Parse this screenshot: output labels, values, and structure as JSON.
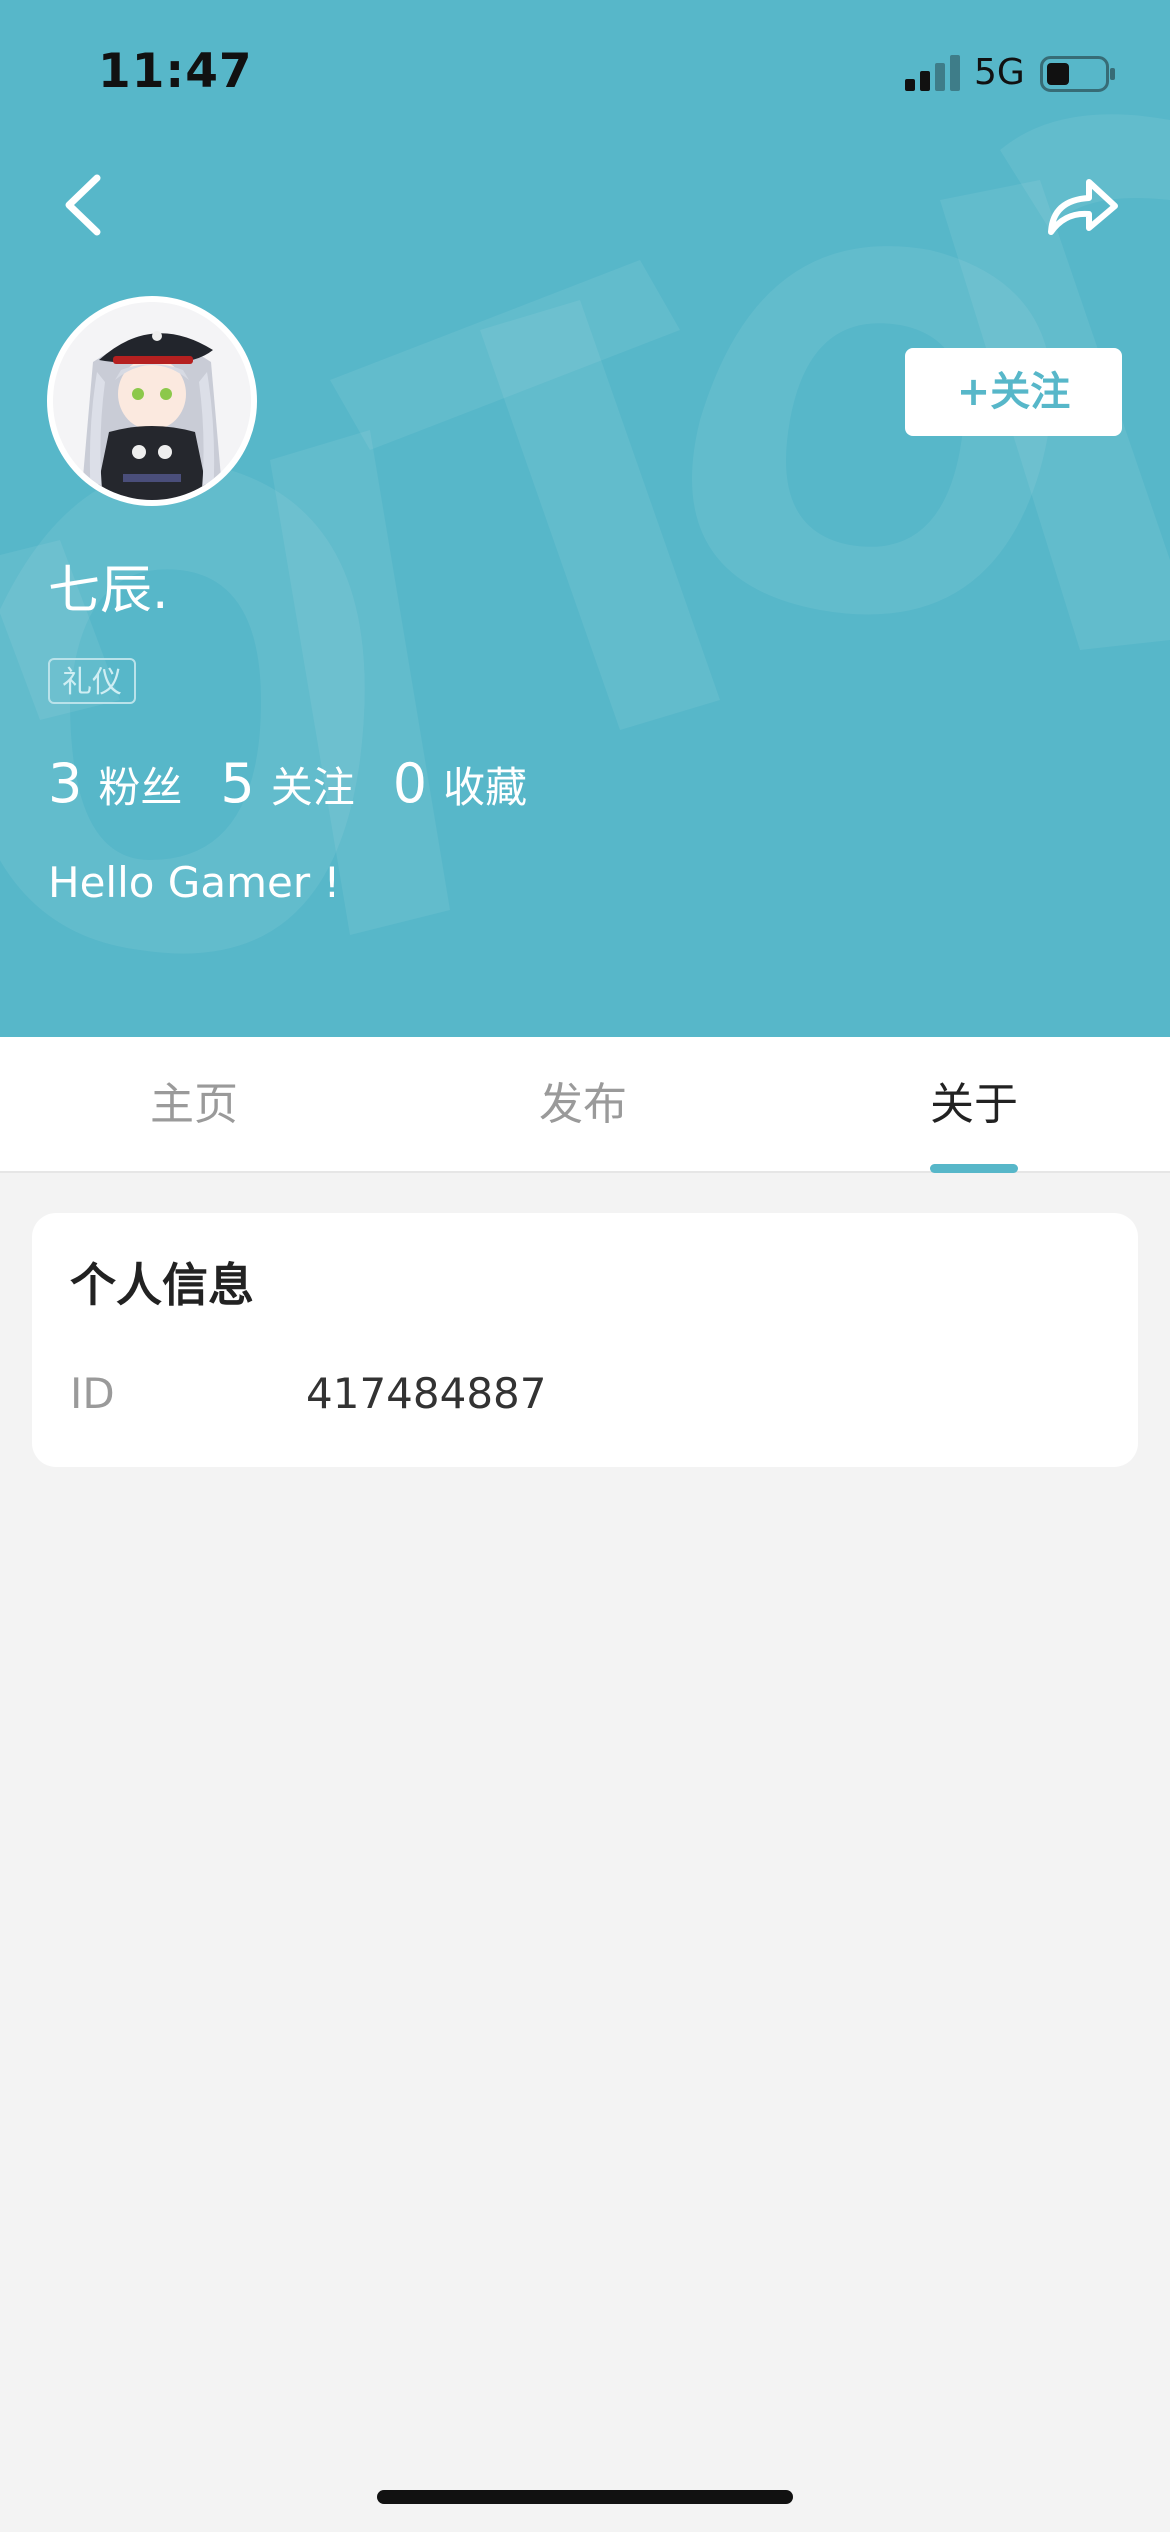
{
  "status_bar": {
    "time": "11:47",
    "network": "5G"
  },
  "header": {
    "username": "七辰.",
    "tag": "礼仪",
    "follow_label": "+关注",
    "bio": "Hello Gamer !",
    "background_color": "#57b7c9",
    "stats": [
      {
        "value": "3",
        "label": "粉丝"
      },
      {
        "value": "5",
        "label": "关注"
      },
      {
        "value": "0",
        "label": "收藏"
      }
    ]
  },
  "tabs": [
    {
      "label": "主页",
      "active": false
    },
    {
      "label": "发布",
      "active": false
    },
    {
      "label": "关于",
      "active": true
    }
  ],
  "info_card": {
    "title": "个人信息",
    "rows": [
      {
        "label": "ID",
        "value": "417484887"
      }
    ]
  },
  "icons": {
    "back": "chevron-left-icon",
    "share": "share-arrow-icon",
    "signal": "signal-bars-icon",
    "battery": "battery-icon"
  },
  "colors": {
    "accent": "#57b7c9",
    "page_background": "#f3f3f3"
  }
}
